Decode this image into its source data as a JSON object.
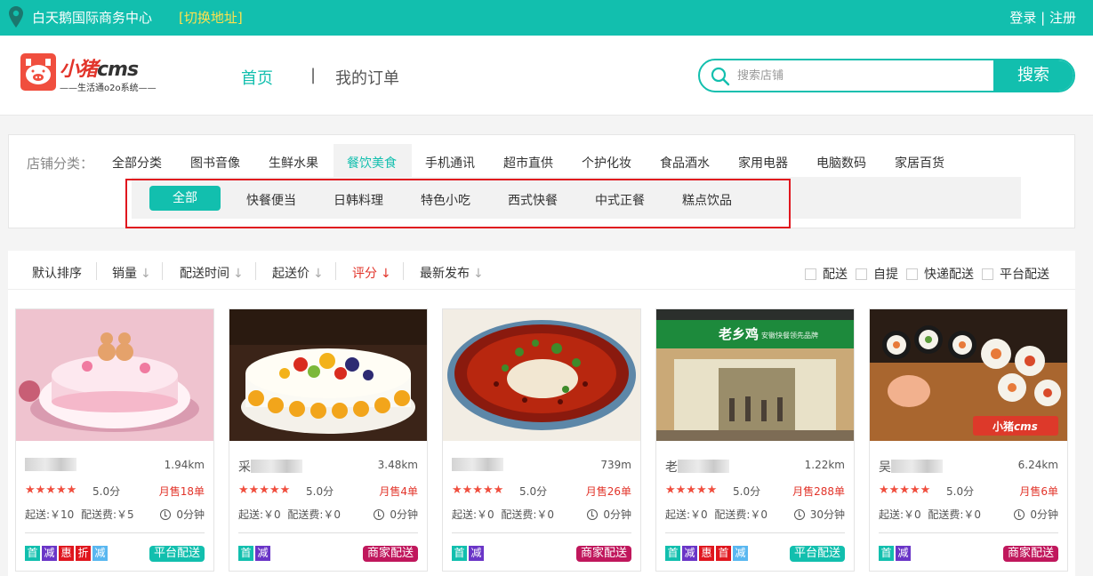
{
  "topbar": {
    "location": "白天鹅国际商务中心",
    "switch_label": "[切换地址]",
    "login": "登录",
    "auth_sep": " | ",
    "register": "注册"
  },
  "header": {
    "logo_name_a": "小猪",
    "logo_name_b": "cms",
    "logo_slogan": "——生活通o2o系统——",
    "nav_home": "首页",
    "nav_sep": "|",
    "nav_orders": "我的订单",
    "search_placeholder": "搜索店铺",
    "search_button": "搜索"
  },
  "categories": {
    "label": "店铺分类：",
    "items": [
      "全部分类",
      "图书音像",
      "生鲜水果",
      "餐饮美食",
      "手机通讯",
      "超市直供",
      "个护化妆",
      "食品酒水",
      "家用电器",
      "电脑数码",
      "家居百货"
    ],
    "active": "餐饮美食",
    "sub_items": [
      "全部",
      "快餐便当",
      "日韩料理",
      "特色小吃",
      "西式快餐",
      "中式正餐",
      "糕点饮品"
    ],
    "sub_active": "全部"
  },
  "sort": {
    "items": [
      {
        "label": "默认排序",
        "arrow": ""
      },
      {
        "label": "销量",
        "arrow": "↓"
      },
      {
        "label": "配送时间",
        "arrow": "↓"
      },
      {
        "label": "起送价",
        "arrow": "↓"
      },
      {
        "label": "评分",
        "arrow": "↓"
      },
      {
        "label": "最新发布",
        "arrow": "↓"
      }
    ],
    "active": "评分",
    "filters": [
      "配送",
      "自提",
      "快递配送",
      "平台配送"
    ]
  },
  "shops": [
    {
      "name_visible": "",
      "distance": "1.94km",
      "stars": "★★★★★",
      "score": "5.0分",
      "sales": "月售18单",
      "min_order": "起送:￥10",
      "delivery_fee": "配送费:￥5",
      "time": "0分钟",
      "badges": [
        "首",
        "减",
        "惠",
        "折",
        "减"
      ],
      "delivery": "平台配送",
      "delivery_type": "platform"
    },
    {
      "name_visible": "采",
      "distance": "3.48km",
      "stars": "★★★★★",
      "score": "5.0分",
      "sales": "月售4单",
      "min_order": "起送:￥0",
      "delivery_fee": "配送费:￥0",
      "time": "0分钟",
      "badges": [
        "首",
        "减"
      ],
      "delivery": "商家配送",
      "delivery_type": "shop"
    },
    {
      "name_visible": "",
      "distance": "739m",
      "stars": "★★★★★",
      "score": "5.0分",
      "sales": "月售26单",
      "min_order": "起送:￥0",
      "delivery_fee": "配送费:￥0",
      "time": "0分钟",
      "badges": [
        "首",
        "减"
      ],
      "delivery": "商家配送",
      "delivery_type": "shop"
    },
    {
      "name_visible": "老",
      "distance": "1.22km",
      "stars": "★★★★★",
      "score": "5.0分",
      "sales": "月售288单",
      "min_order": "起送:￥0",
      "delivery_fee": "配送费:￥0",
      "time": "30分钟",
      "badges": [
        "首",
        "减",
        "惠",
        "首",
        "减"
      ],
      "delivery": "平台配送",
      "delivery_type": "platform"
    },
    {
      "name_visible": "吴",
      "distance": "6.24km",
      "stars": "★★★★★",
      "score": "5.0分",
      "sales": "月售6单",
      "min_order": "起送:￥0",
      "delivery_fee": "配送费:￥0",
      "time": "0分钟",
      "badges": [
        "首",
        "减"
      ],
      "delivery": "商家配送",
      "delivery_type": "shop"
    }
  ],
  "image_signs": {
    "shop4_sign": "老乡鸡",
    "shop4_sign_sub": "安徽快餐领先品牌",
    "shop5_watermark_a": "小猪",
    "shop5_watermark_b": "cms"
  },
  "colors": {
    "brand": "#12bfae",
    "accent_red": "#e2342a",
    "switch_yellow": "#ffe14d",
    "platform_badge": "#12bfae",
    "shop_badge": "#c0175c"
  }
}
